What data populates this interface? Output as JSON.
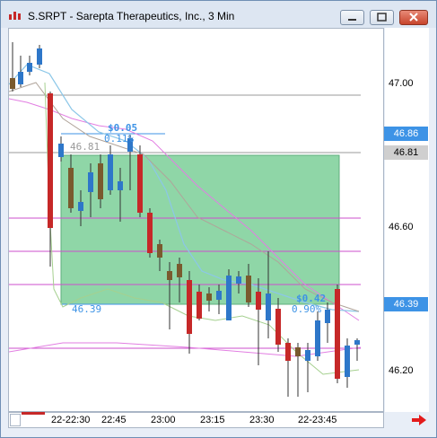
{
  "window": {
    "title": "S.SRPT - Sarepta Therapeutics, Inc., 3 Min",
    "minimize_icon": "minimize-icon",
    "maximize_icon": "maximize-icon",
    "close_icon": "close-icon"
  },
  "price_axis": {
    "ticks": [
      "47.00",
      "46.60",
      "46.20"
    ]
  },
  "price_badges": {
    "blue_upper": "46.86",
    "gray": "46.81",
    "blue_lower": "46.39"
  },
  "time_axis": {
    "ticks": [
      "22-22:30",
      "22:45",
      "23:00",
      "23:15",
      "23:30",
      "22-23:45"
    ]
  },
  "annotations": {
    "upper_change": "$0.05",
    "upper_pct": "0.11%",
    "upper_price": "46.81",
    "lower_price": "46.39",
    "lower_change": "$0.42",
    "lower_pct": "0.90%"
  },
  "colors": {
    "up_candle": "#2e77c9",
    "down_candle": "#c62828",
    "neutral_candle": "#7a5a2e",
    "highlight_rect": "#8fd6a7",
    "badge_blue": "#3d93e6",
    "badge_gray": "#cfcfcf"
  },
  "navigation": {
    "scroll_right_icon": "arrow-right-icon"
  }
}
